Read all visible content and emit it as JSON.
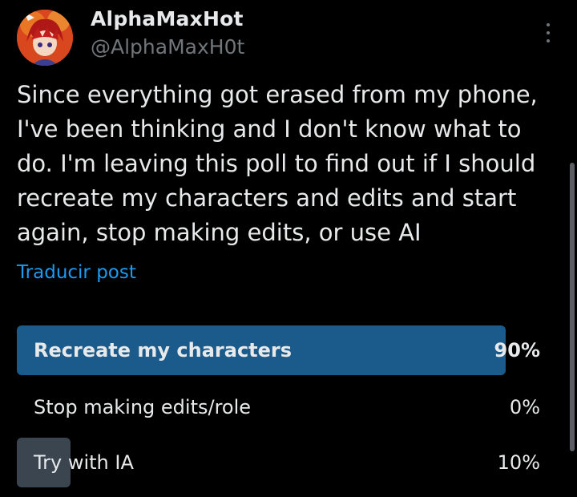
{
  "author": {
    "display_name": "AlphaMaxHot",
    "handle": "@AlphaMaxH0t"
  },
  "post": {
    "text": "Since everything got erased from my phone, I've been thinking and I don't know what to do. I'm leaving this poll to find out if I should recreate my characters and edits and start again, stop making edits, or use AI",
    "translate_label": "Traducir post"
  },
  "poll": {
    "options": [
      {
        "label": "Recreate my characters",
        "percent": "90%",
        "value": 90,
        "winner": true
      },
      {
        "label": "Stop making edits/role",
        "percent": "0%",
        "value": 0,
        "winner": false
      },
      {
        "label": "Try with IA",
        "percent": "10%",
        "value": 10,
        "winner": false
      }
    ]
  },
  "colors": {
    "background": "#000000",
    "text": "#e7e9ea",
    "muted": "#71767b",
    "link": "#1d9bf0",
    "winner_bar": "#1a5b8c",
    "other_bar": "#3a4550"
  },
  "icons": {
    "more": "more-vertical-icon"
  }
}
